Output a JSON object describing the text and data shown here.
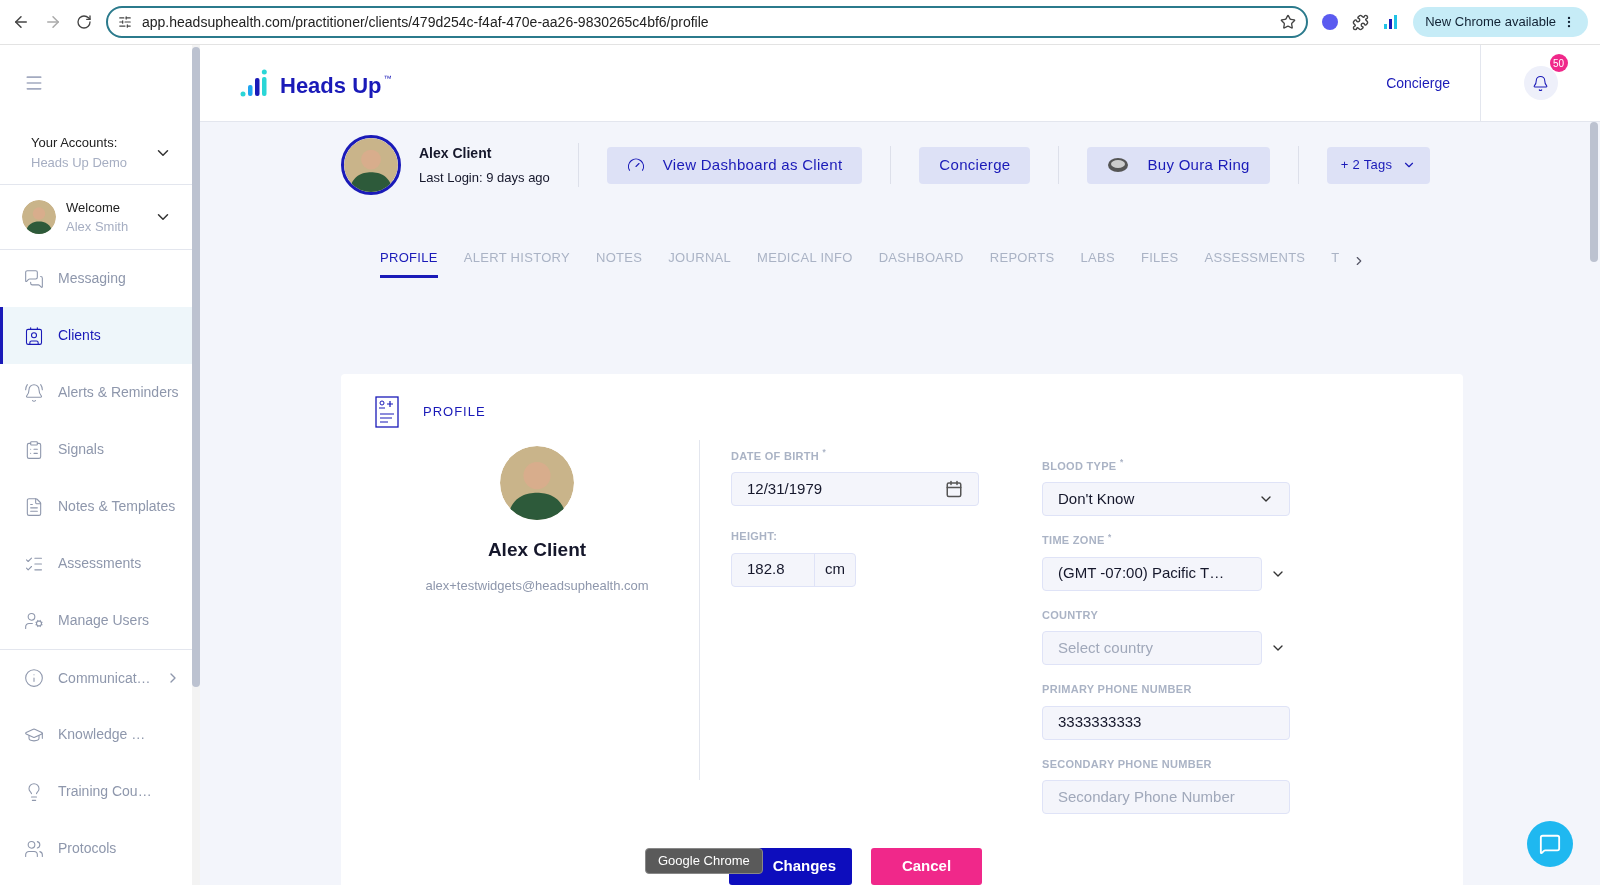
{
  "browser": {
    "url": "app.headsuphealth.com/practitioner/clients/479d254c-f4af-470e-aa26-9830265c4bf6/profile",
    "update_button": "New Chrome available"
  },
  "sidebar": {
    "accounts_label": "Your Accounts:",
    "account_name": "Heads Up Demo",
    "welcome": "Welcome",
    "user_name": "Alex Smith",
    "main_items": [
      {
        "label": "Messaging",
        "selected": false
      },
      {
        "label": "Clients",
        "selected": true
      },
      {
        "label": "Alerts & Reminders",
        "selected": false
      },
      {
        "label": "Signals",
        "selected": false
      },
      {
        "label": "Notes & Templates",
        "selected": false
      },
      {
        "label": "Assessments",
        "selected": false
      },
      {
        "label": "Manage Users",
        "selected": false
      }
    ],
    "more_items": [
      {
        "label": "Communicat…",
        "selected": false,
        "submenu": true
      },
      {
        "label": "Knowledge …",
        "selected": false,
        "submenu": false
      },
      {
        "label": "Training Cou…",
        "selected": false,
        "submenu": false
      },
      {
        "label": "Protocols",
        "selected": false,
        "submenu": false
      }
    ]
  },
  "header": {
    "logo_text": "Heads Up",
    "trademark": "™",
    "concierge_link": "Concierge",
    "notification_count": "50"
  },
  "client": {
    "name": "Alex Client",
    "last_login": "Last Login: 9 days ago",
    "actions": [
      {
        "label": "View Dashboard as Client",
        "kind": "dashboard"
      },
      {
        "label": "Concierge",
        "kind": "plain"
      },
      {
        "label": "Buy Oura Ring",
        "kind": "ring"
      },
      {
        "label": "+ 2 Tags",
        "kind": "tags"
      }
    ]
  },
  "tabs": [
    {
      "label": "PROFILE",
      "selected": true
    },
    {
      "label": "ALERT HISTORY",
      "selected": false
    },
    {
      "label": "NOTES",
      "selected": false
    },
    {
      "label": "JOURNAL",
      "selected": false
    },
    {
      "label": "MEDICAL INFO",
      "selected": false
    },
    {
      "label": "DASHBOARD",
      "selected": false
    },
    {
      "label": "REPORTS",
      "selected": false
    },
    {
      "label": "LABS",
      "selected": false
    },
    {
      "label": "FILES",
      "selected": false
    },
    {
      "label": "ASSESSMENTS",
      "selected": false
    },
    {
      "label": "T",
      "selected": false
    }
  ],
  "profile": {
    "title": "PROFILE",
    "name": "Alex Client",
    "email": "alex+testwidgets@headsuphealth.com",
    "left_fields": [
      {
        "label": "DATE OF BIRTH $^{*}$",
        "kind": "date",
        "value": "12/31/1979"
      },
      {
        "label": "HEIGHT:",
        "kind": "unit",
        "value": "182.8",
        "unit": "cm"
      }
    ],
    "right_fields": [
      {
        "label": "BLOOD TYPE $^{*}$",
        "kind": "select",
        "value": "Don't Know"
      },
      {
        "label": "TIME ZONE $^{*}$",
        "kind": "select_outside",
        "value": "(GMT -07:00) Pacific T…"
      },
      {
        "label": "COUNTRY",
        "kind": "select_outside",
        "placeholder": "Select country"
      },
      {
        "label": "PRIMARY PHONE NUMBER",
        "kind": "text",
        "value": "3333333333"
      },
      {
        "label": "SECONDARY PHONE NUMBER",
        "kind": "text",
        "placeholder": "Secondary Phone Number"
      }
    ],
    "save_button": "Changes",
    "cancel_button": "Cancel"
  },
  "tooltip": "Google Chrome"
}
